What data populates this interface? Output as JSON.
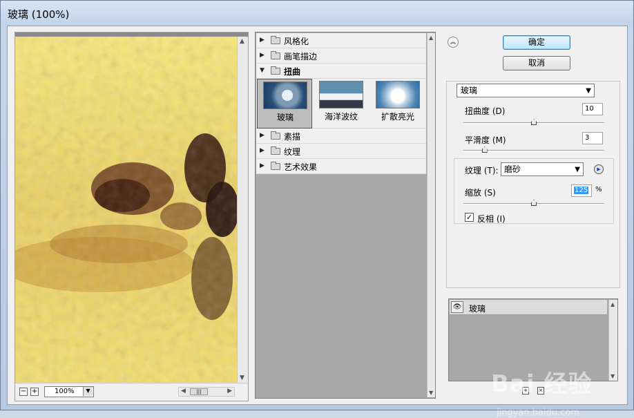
{
  "window": {
    "title": "玻璃 (100%)"
  },
  "preview": {
    "zoom_value": "100%",
    "zoom_out_label": "−",
    "zoom_in_label": "+"
  },
  "gallery": {
    "categories_top": [
      {
        "label": "风格化",
        "expanded": false
      },
      {
        "label": "画笔描边",
        "expanded": false
      },
      {
        "label": "扭曲",
        "expanded": true
      }
    ],
    "thumbnails": [
      {
        "label": "玻璃",
        "selected": true
      },
      {
        "label": "海洋波纹",
        "selected": false
      },
      {
        "label": "扩散亮光",
        "selected": false
      }
    ],
    "categories_bottom": [
      {
        "label": "素描",
        "expanded": false
      },
      {
        "label": "纹理",
        "expanded": false
      },
      {
        "label": "艺术效果",
        "expanded": false
      }
    ]
  },
  "buttons": {
    "ok": "确定",
    "cancel": "取消"
  },
  "settings": {
    "filter_select": "玻璃",
    "distortion_label": "扭曲度 (D)",
    "distortion_value": "10",
    "distortion_level": 0.5,
    "smoothness_label": "平滑度 (M)",
    "smoothness_value": "3",
    "smoothness_level": 0.15,
    "texture_label": "纹理 (T):",
    "texture_value": "磨砂",
    "scaling_label": "缩放 (S)",
    "scaling_value": "125",
    "scaling_unit": "%",
    "scaling_level": 0.5,
    "invert_label": "反相 (I)",
    "invert_checked": true
  },
  "layers": {
    "items": [
      {
        "name": "玻璃",
        "visible": true
      }
    ]
  },
  "watermark": {
    "brand": "Bai 经验",
    "url": "jingyan.baidu.com"
  },
  "colors": {
    "accent": "#3399ff",
    "default_button_border": "#3c7fb1"
  }
}
